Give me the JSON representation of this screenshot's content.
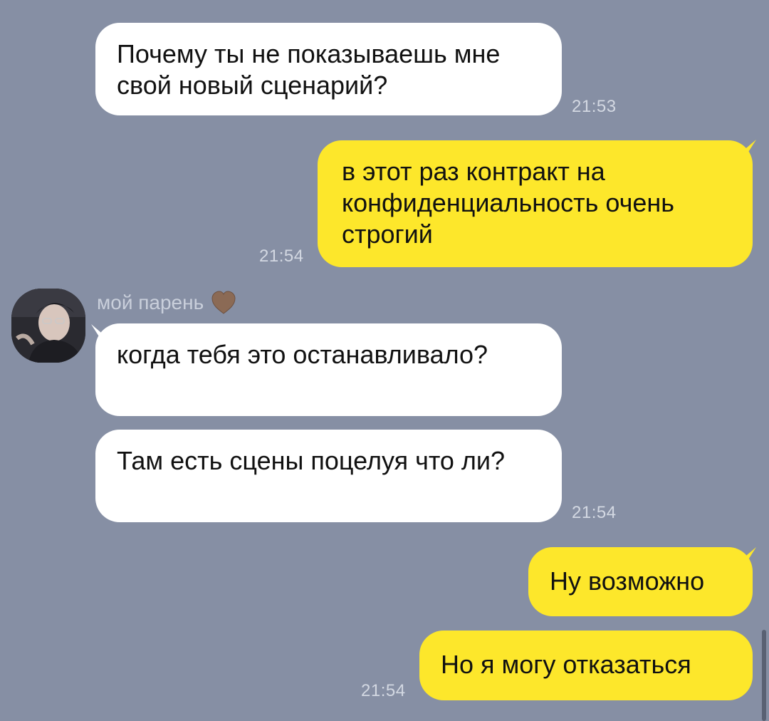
{
  "contact": {
    "name": "мой парень"
  },
  "messages": [
    {
      "text": "Почему ты не показываешь мне свой новый сценарий?",
      "time": "21:53"
    },
    {
      "text": "в этот раз контракт на конфиденциальность очень строгий",
      "time": "21:54"
    },
    {
      "text": "когда тебя это останавливало?"
    },
    {
      "text": "Там есть сцены поцелуя что ли?",
      "time": "21:54"
    },
    {
      "text": "Ну возможно"
    },
    {
      "text": "Но я могу отказаться",
      "time": "21:54"
    }
  ],
  "colors": {
    "background": "#868fa4",
    "incoming_bubble": "#ffffff",
    "outgoing_bubble": "#fde72b",
    "timestamp": "#d3d8e2",
    "sender_name": "#c9cfdb"
  },
  "icons": {
    "heart": "brown-heart-emoji"
  }
}
